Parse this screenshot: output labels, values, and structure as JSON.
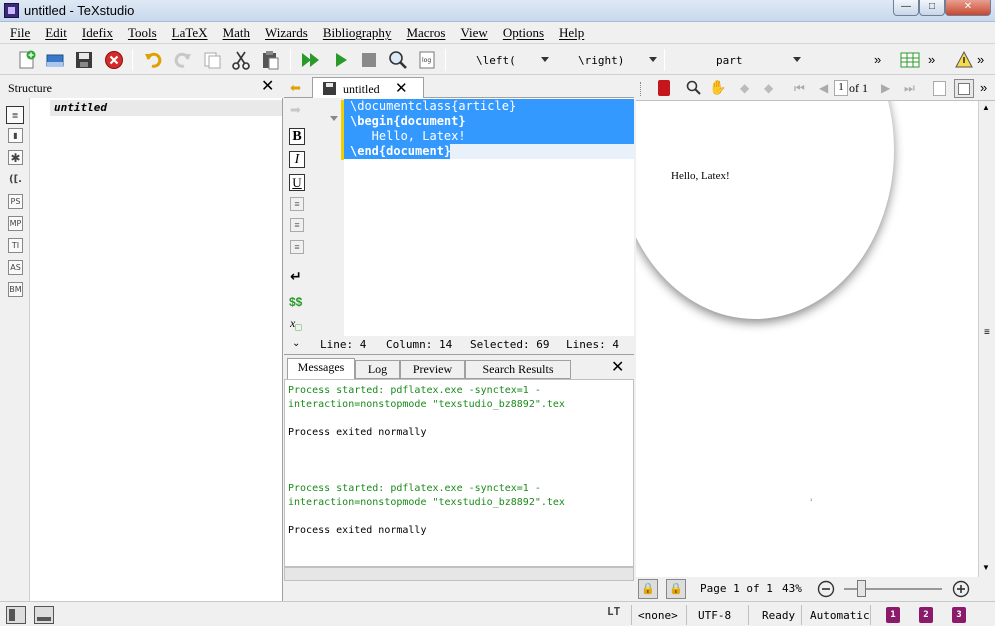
{
  "window": {
    "title": "untitled - TeXstudio"
  },
  "menu": [
    "File",
    "Edit",
    "Idefix",
    "Tools",
    "LaTeX",
    "Math",
    "Wizards",
    "Bibliography",
    "Macros",
    "View",
    "Options",
    "Help"
  ],
  "toolbar": {
    "left_combo": "\\left(",
    "right_combo": "\\right)",
    "section_combo": "part",
    "overflow": "»"
  },
  "structure": {
    "title": "Structure",
    "tree_item": "untitled",
    "side_icons": [
      "PS",
      "MP",
      "TI",
      "AS",
      "BM"
    ]
  },
  "editor": {
    "tab_label": "untitled",
    "lines": [
      "\\documentclass{article}",
      "\\begin{document}",
      "   Hello, Latex!",
      "\\end{document}"
    ],
    "status": {
      "line": "Line: 4",
      "column": "Column: 14",
      "selected": "Selected: 69",
      "lines": "Lines: 4"
    }
  },
  "messages": {
    "tabs": [
      "Messages",
      "Log",
      "Preview",
      "Search Results"
    ],
    "lines": [
      "Process started: pdflatex.exe -synctex=1 -",
      "interaction=nonstopmode \"texstudio_bz8892\".tex",
      "Process exited normally",
      "Process started: pdflatex.exe -synctex=1 -",
      "interaction=nonstopmode \"texstudio_bz8892\".tex",
      "Process exited normally"
    ]
  },
  "pdf": {
    "page_input": "1",
    "of_pages": "of 1",
    "content": "Hello, Latex!",
    "page_label": "Page 1 of 1",
    "zoom": "43%"
  },
  "statusbar": {
    "language": "<none>",
    "encoding": "UTF-8",
    "state": "Ready",
    "mode": "Automatic"
  },
  "colors": {
    "selection": "#3399ff",
    "accent_green": "#1a8a1a"
  }
}
